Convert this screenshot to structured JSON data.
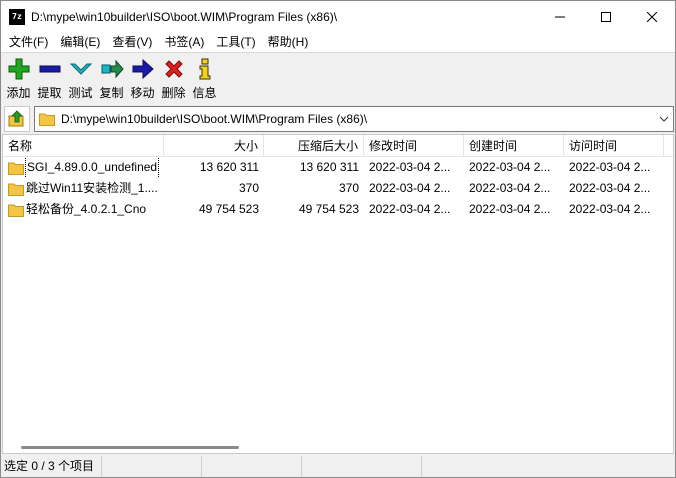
{
  "window": {
    "title": "D:\\mype\\win10builder\\ISO\\boot.WIM\\Program Files (x86)\\",
    "app_icon_text": "7z"
  },
  "menu": [
    {
      "label": "文件(F)"
    },
    {
      "label": "编辑(E)"
    },
    {
      "label": "查看(V)"
    },
    {
      "label": "书签(A)"
    },
    {
      "label": "工具(T)"
    },
    {
      "label": "帮助(H)"
    }
  ],
  "toolbar": [
    {
      "label": "添加",
      "icon": "add-icon"
    },
    {
      "label": "提取",
      "icon": "extract-icon"
    },
    {
      "label": "测试",
      "icon": "test-icon"
    },
    {
      "label": "复制",
      "icon": "copy-icon"
    },
    {
      "label": "移动",
      "icon": "move-icon"
    },
    {
      "label": "删除",
      "icon": "delete-icon"
    },
    {
      "label": "信息",
      "icon": "info-icon"
    }
  ],
  "address": {
    "value": "D:\\mype\\win10builder\\ISO\\boot.WIM\\Program Files (x86)\\"
  },
  "columns": {
    "name": "名称",
    "size": "大小",
    "packed": "压缩后大小",
    "modified": "修改时间",
    "created": "创建时间",
    "accessed": "访问时间"
  },
  "rows": [
    {
      "name": "SGI_4.89.0.0_undefined",
      "size": "13 620 311",
      "packed": "13 620 311",
      "modified": "2022-03-04 2...",
      "created": "2022-03-04 2...",
      "accessed": "2022-03-04 2..."
    },
    {
      "name": "跳过Win11安装检测_1....",
      "size": "370",
      "packed": "370",
      "modified": "2022-03-04 2...",
      "created": "2022-03-04 2...",
      "accessed": "2022-03-04 2..."
    },
    {
      "name": "轻松备份_4.0.2.1_Cno",
      "size": "49 754 523",
      "packed": "49 754 523",
      "modified": "2022-03-04 2...",
      "created": "2022-03-04 2...",
      "accessed": "2022-03-04 2..."
    }
  ],
  "status": {
    "selection": "选定 0 / 3 个项目",
    "seg2": "",
    "seg3": "",
    "seg4": ""
  },
  "colors": {
    "folder": "#f4c542",
    "add_green": "#1fa81f",
    "extract_blue": "#1a1aa8",
    "test_teal": "#17b8c4",
    "delete_red": "#e02020",
    "info_yellow": "#f2d21c"
  }
}
